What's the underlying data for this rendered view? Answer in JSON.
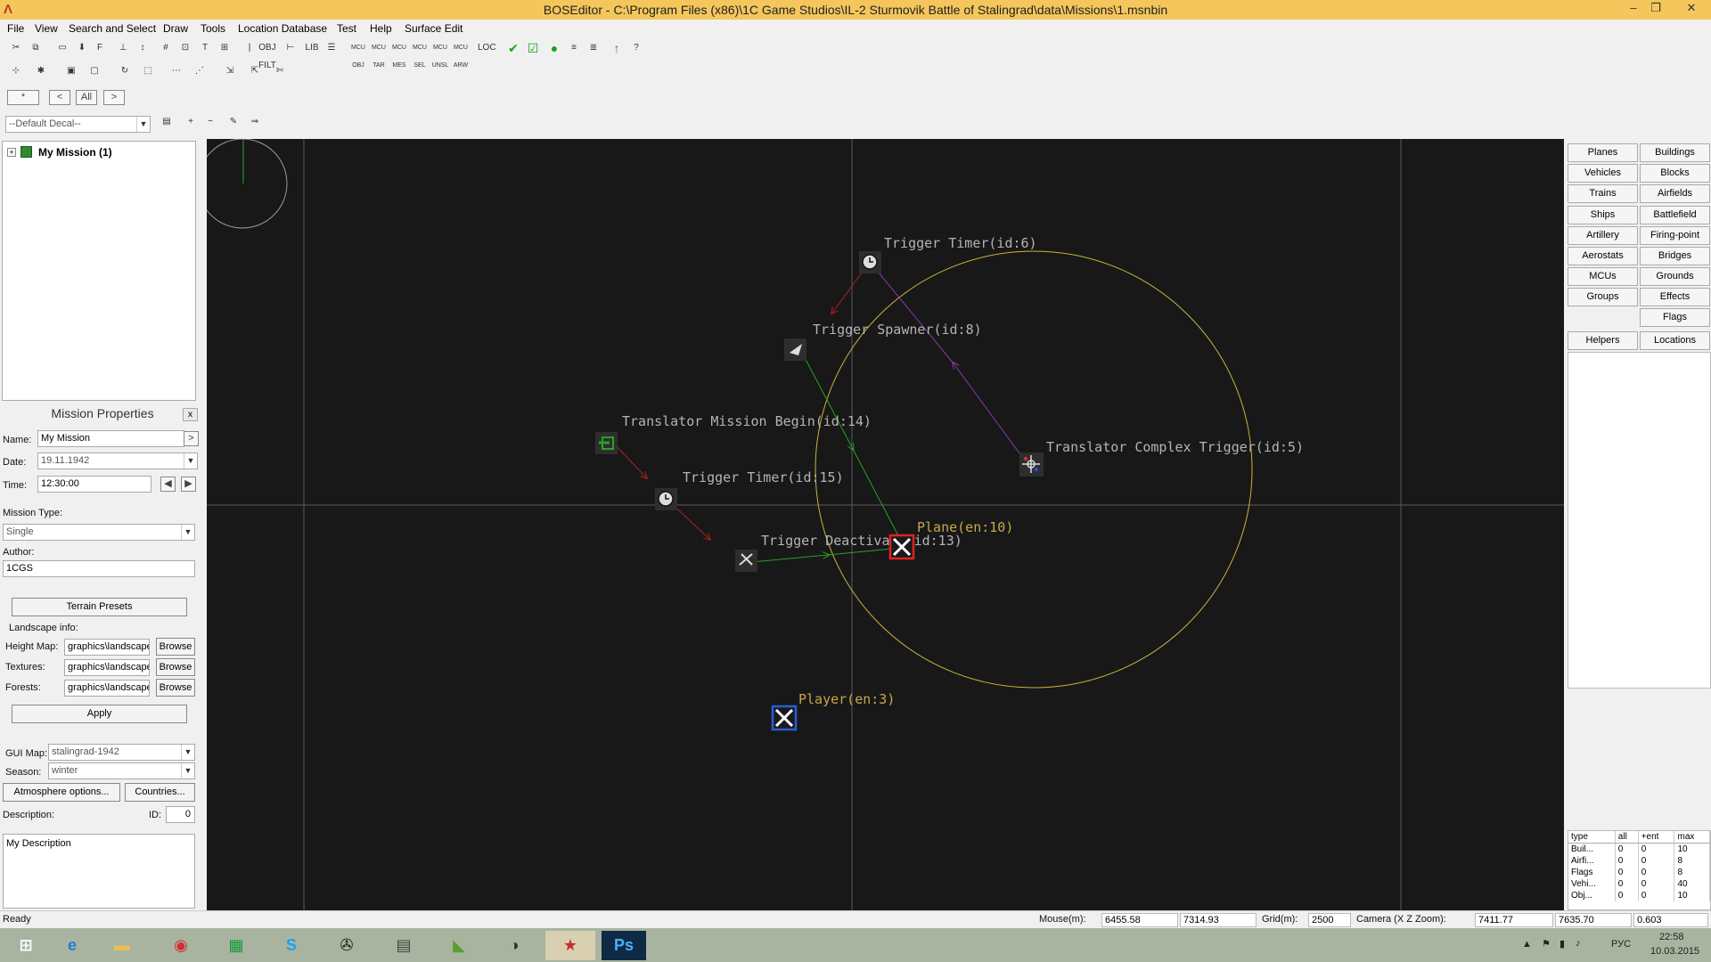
{
  "window": {
    "app_icon": "bos-editor-icon",
    "title": "BOSEditor - C:\\Program Files (x86)\\1C Game Studios\\IL-2 Sturmovik Battle of Stalingrad\\data\\Missions\\1.msnbin",
    "minimize": "–",
    "restore": "❐",
    "close": "✕"
  },
  "menu": [
    "File",
    "View",
    "Search and Select",
    "Draw",
    "Tools",
    "Location Database",
    "Test",
    "Help",
    "Surface Edit"
  ],
  "toolbar": {
    "labels": [
      "OBJ FILT",
      "LIB",
      "MCU OBJ",
      "MCU TAR",
      "MCU MES",
      "MCU SEL",
      "MCU UNSL",
      "MCU ARW",
      "LOC"
    ],
    "nav_star": "*",
    "nav_prev": "<",
    "nav_all": "All",
    "nav_next": ">",
    "decal_select": "--Default Decal--"
  },
  "tree": {
    "expander": "+",
    "root_label": "My Mission (1)"
  },
  "mission_properties": {
    "header": "Mission Properties",
    "close": "x",
    "name_label": "Name:",
    "name_value": "My Mission",
    "name_btn": ">",
    "date_label": "Date:",
    "date_value": "19.11.1942",
    "time_label": "Time:",
    "time_value": "12:30:00",
    "mission_type_label": "Mission Type:",
    "mission_type_value": "Single",
    "author_label": "Author:",
    "author_value": "1CGS",
    "terrain_presets": "Terrain Presets",
    "landscape_info": "Landscape info:",
    "height_map_label": "Height Map:",
    "height_map_value": "graphics\\landscape",
    "textures_label": "Textures:",
    "textures_value": "graphics\\landscape",
    "forests_label": "Forests:",
    "forests_value": "graphics\\landscape",
    "browse": "Browse",
    "apply": "Apply",
    "gui_map_label": "GUI Map:",
    "gui_map_value": "stalingrad-1942",
    "season_label": "Season:",
    "season_value": "winter",
    "atmosphere_btn": "Atmosphere options...",
    "countries_btn": "Countries...",
    "description_label": "Description:",
    "id_label": "ID:",
    "id_value": "0",
    "description_value": "My Description"
  },
  "map": {
    "labels": {
      "trigger_timer_6": "Trigger Timer(id:6)",
      "trigger_spawner_8": "Trigger Spawner(id:8)",
      "translator_mission_begin_14": "Translator Mission Begin(id:14)",
      "translator_complex_trigger_5": "Translator Complex Trigger(id:5)",
      "trigger_timer_15": "Trigger Timer(id:15)",
      "plane_10": "Plane(en:10)",
      "trigger_deactivate_13": "Trigger Deactivate(id:13)",
      "player_3": "Player(en:3)"
    },
    "colors": {
      "background": "#181818",
      "grid": "#5a5a5a",
      "radius_circle": "#c8b43c",
      "object_label": "#c8a84a",
      "mcu_label": "#b4b4b4",
      "link_red": "#b02020",
      "link_green": "#28a028",
      "link_purple": "#8a3aa8",
      "enemy_marker": "#e02020",
      "friendly_marker": "#2a5ad8"
    }
  },
  "right_panel": {
    "buttons": [
      [
        "Planes",
        "Buildings"
      ],
      [
        "Vehicles",
        "Blocks"
      ],
      [
        "Trains",
        "Airfields"
      ],
      [
        "Ships",
        "Battlefield"
      ],
      [
        "Artillery",
        "Firing-point"
      ],
      [
        "Aerostats",
        "Bridges"
      ],
      [
        "MCUs",
        "Grounds"
      ],
      [
        "Groups",
        "Effects"
      ],
      [
        "",
        "Flags"
      ],
      [
        "Helpers",
        "Locations"
      ]
    ],
    "stats": {
      "headers": [
        "type",
        "all",
        "+ent",
        "max"
      ],
      "rows": [
        [
          "Buil...",
          "0",
          "0",
          "10"
        ],
        [
          "Airfi...",
          "0",
          "0",
          "8"
        ],
        [
          "Flags",
          "0",
          "0",
          "8"
        ],
        [
          "Vehi...",
          "0",
          "0",
          "40"
        ],
        [
          "Obj...",
          "0",
          "0",
          "10"
        ]
      ]
    }
  },
  "status": {
    "ready": "Ready",
    "mouse_label": "Mouse(m):",
    "mouse_x": "6455.58",
    "mouse_y": "7314.93",
    "grid_label": "Grid(m):",
    "grid_value": "2500",
    "camera_label": "Camera (X Z Zoom):",
    "camera_x": "7411.77",
    "camera_z": "7635.70",
    "camera_zoom": "0.603"
  },
  "taskbar": {
    "apps": [
      "windows-start-icon",
      "internet-explorer-icon",
      "file-explorer-icon",
      "chrome-icon",
      "store-icon",
      "skype-icon",
      "steam-like-icon",
      "dcs-icon",
      "nvidia-icon",
      "teamspeak-icon",
      "bos-editor-icon",
      "photoshop-icon"
    ],
    "ps_label": "Ps",
    "lang": "РУС",
    "time": "22:58",
    "date": "10.03.2015"
  }
}
